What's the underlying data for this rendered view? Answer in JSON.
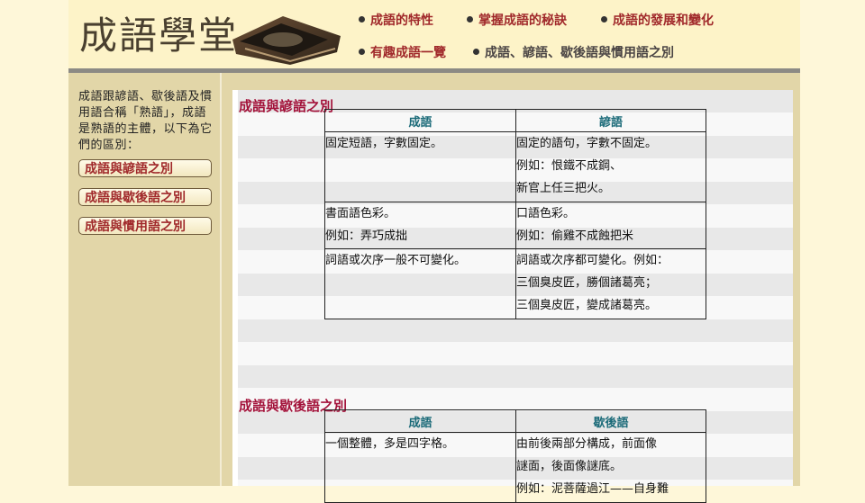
{
  "site": {
    "logo": "成語學堂"
  },
  "nav": {
    "items": [
      {
        "label": "成語的特性"
      },
      {
        "label": "掌握成語的秘訣"
      },
      {
        "label": "成語的發展和變化"
      },
      {
        "label": "有趣成語一覽"
      },
      {
        "label": "成語、諺語、歇後語與慣用語之別"
      }
    ]
  },
  "sidebar": {
    "intro": "成語跟諺語、歇後語及慣用語合稱「熟語」，成語是熟語的主體，以下為它們的區別：",
    "links": [
      {
        "label": "成語與諺語之別"
      },
      {
        "label": "成語與歇後語之別"
      },
      {
        "label": "成語與慣用語之別"
      }
    ]
  },
  "sections": [
    {
      "title": "成語與諺語之別",
      "headers": [
        "成語",
        "諺語"
      ],
      "rows": [
        {
          "left": [
            "固定短語，字數固定。"
          ],
          "right": [
            "固定的語句，字數不固定。",
            "例如：恨鐵不成鋼、",
            "新官上任三把火。"
          ]
        },
        {
          "left": [
            "書面語色彩。",
            "例如：弄巧成拙"
          ],
          "right": [
            "口語色彩。",
            "例如：偷雞不成蝕把米"
          ]
        },
        {
          "left": [
            "詞語或次序一般不可變化。"
          ],
          "right": [
            "詞語或次序都可變化。例如：",
            "三個臭皮匠，勝個諸葛亮；",
            "三個臭皮匠，變成諸葛亮。"
          ]
        }
      ]
    },
    {
      "title": "成語與歇後語之別",
      "headers": [
        "成語",
        "歇後語"
      ],
      "rows": [
        {
          "left": [
            "一個整體，多是四字格。"
          ],
          "right": [
            "由前後兩部分構成，前面像",
            "謎面，後面像謎底。",
            "例如：泥菩薩過江——自身難"
          ]
        }
      ]
    }
  ],
  "colors": {
    "accent": "#a0282a",
    "title": "#a3123a",
    "header_text": "#1a6a78",
    "sidebar_bg": "#e2d6a8",
    "page_bg": "#fef7d9"
  }
}
